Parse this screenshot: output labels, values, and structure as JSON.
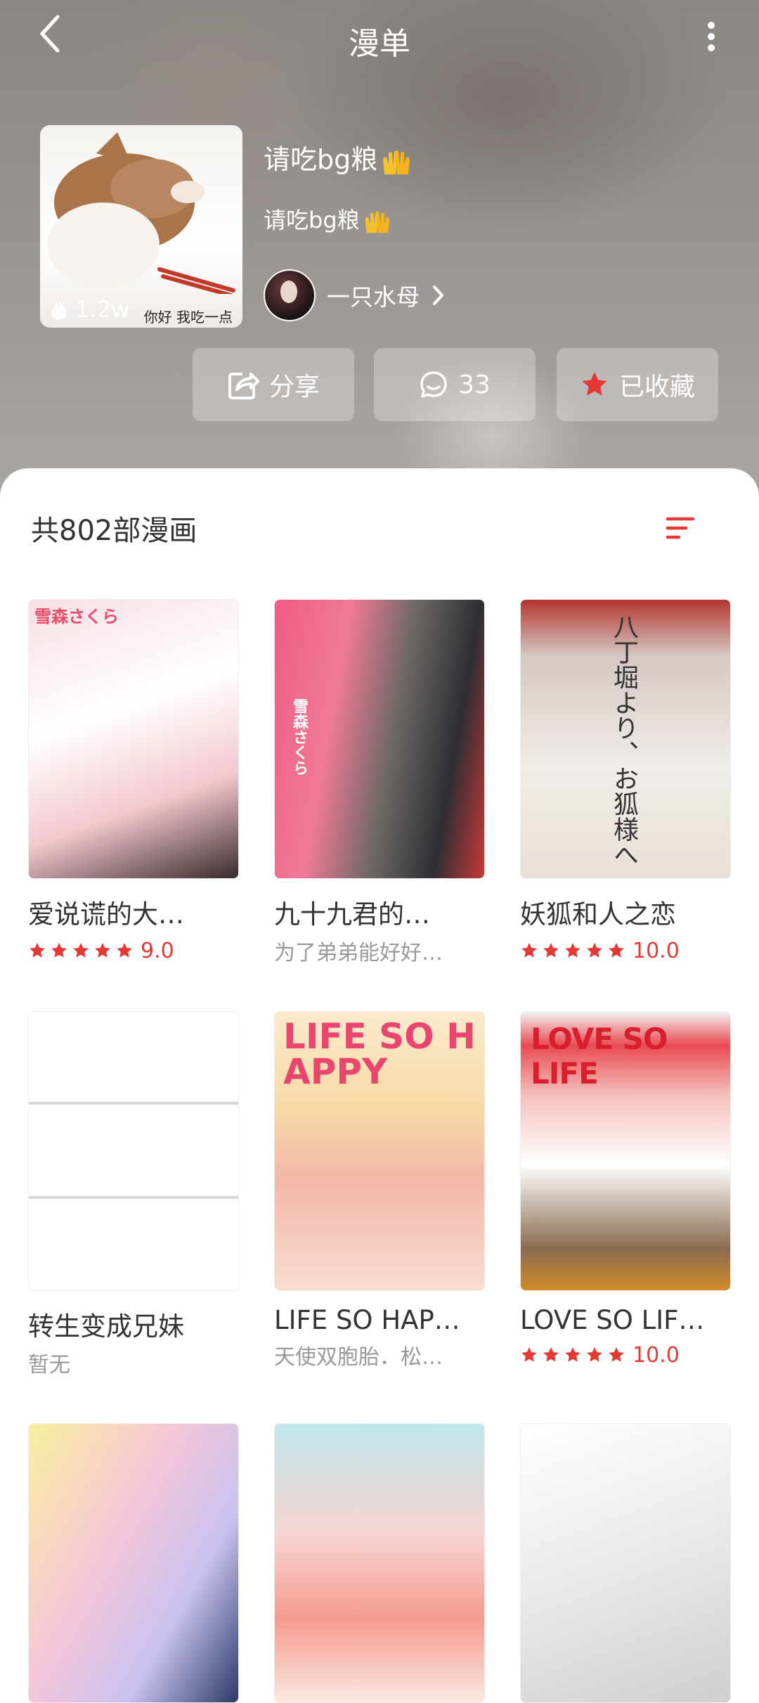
{
  "header": {
    "title": "漫单",
    "back_icon": "chevron-left-icon",
    "more_icon": "more-vertical-icon"
  },
  "list": {
    "title": "请吃bg粮",
    "description": "请吃bg粮",
    "heat": "1.2w",
    "cover_caption": "你好 我吃一点",
    "author": "一只水母"
  },
  "actions": {
    "share_label": "分享",
    "comment_count": "33",
    "favorite_label": "已收藏"
  },
  "colors": {
    "accent": "#e53935",
    "star": "#e53935"
  },
  "content": {
    "count_label": "共802部漫画",
    "items": [
      {
        "name": "爱说谎的大…",
        "sub": "",
        "score": "9.0",
        "rated": true,
        "cover_text": "雪森さくら"
      },
      {
        "name": "九十九君的…",
        "sub": "为了弟弟能好好…",
        "score": "",
        "rated": false,
        "cover_text": "雪森さくら"
      },
      {
        "name": "妖狐和人之恋",
        "sub": "",
        "score": "10.0",
        "rated": true,
        "cover_text": "八丁堀より、お狐様へ"
      },
      {
        "name": "转生变成兄妹",
        "sub": "暂无",
        "score": "",
        "rated": false,
        "cover_text": ""
      },
      {
        "name": "LIFE SO HAP…",
        "sub": "天使双胞胎．松…",
        "score": "",
        "rated": false,
        "cover_text": "LIFE SO HAPPY"
      },
      {
        "name": "LOVE SO LIF…",
        "sub": "",
        "score": "10.0",
        "rated": true,
        "cover_text": "LOVE SO LIFE"
      },
      {
        "name": "",
        "sub": "",
        "score": "",
        "rated": false,
        "cover_text": ""
      },
      {
        "name": "",
        "sub": "",
        "score": "",
        "rated": false,
        "cover_text": ""
      },
      {
        "name": "",
        "sub": "",
        "score": "",
        "rated": false,
        "cover_text": ""
      }
    ]
  }
}
